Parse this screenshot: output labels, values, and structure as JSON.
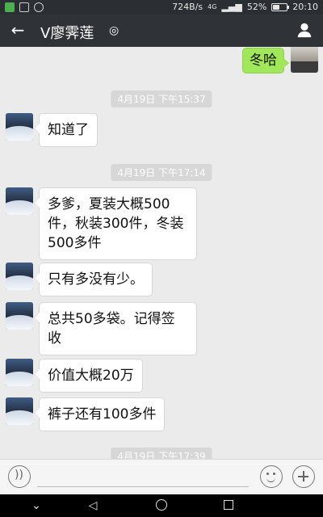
{
  "status_bar": {
    "speed": "724B/s",
    "network": "4G",
    "battery": "52%",
    "battery_fill": 0.52,
    "time": "20:10"
  },
  "header": {
    "title": "V廖霁莲",
    "ear_icon": "ear-icon",
    "profile_icon": "person-icon"
  },
  "messages": {
    "sent_1": "冬哈",
    "t1": "4月19日 下午15:37",
    "m1": "知道了",
    "t2": "4月19日 下午17:14",
    "m2": "多爹，夏装大概500件，秋装300件，冬装500多件",
    "m3": "只有多没有少。",
    "m4": "总共50多袋。记得签收",
    "m5": "价值大概20万",
    "m6": "裤子还有100多件",
    "t3": "4月19日 下午17:39"
  },
  "colors": {
    "sent_bubble": "#a0e75a",
    "received_bubble": "#ffffff",
    "header": "#2f3337",
    "chat_bg": "#ebebeb"
  }
}
